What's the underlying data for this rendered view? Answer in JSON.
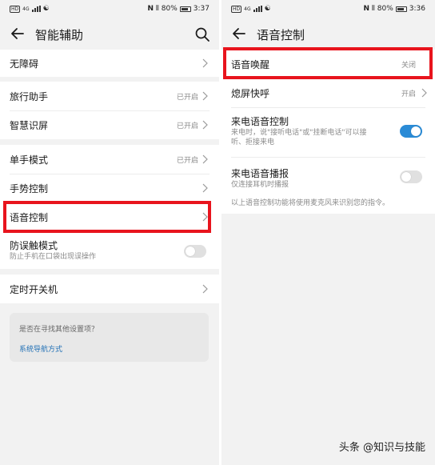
{
  "left": {
    "status": {
      "carrier": "HD",
      "signal": "4G",
      "battery": "80%",
      "time": "3:37"
    },
    "title": "智能辅助",
    "items": [
      {
        "label": "无障碍"
      },
      {
        "label": "旅行助手",
        "value": "已开启"
      },
      {
        "label": "智慧识屏",
        "value": "已开启"
      },
      {
        "label": "单手模式",
        "value": "已开启"
      },
      {
        "label": "手势控制"
      },
      {
        "label": "语音控制"
      },
      {
        "label": "防误触模式",
        "sub": "防止手机在口袋出现误操作",
        "toggle": "off"
      },
      {
        "label": "定时开关机"
      }
    ],
    "hint": {
      "question": "是否在寻找其他设置项？",
      "link": "系统导航方式"
    }
  },
  "right": {
    "status": {
      "carrier": "HD",
      "signal": "4G",
      "battery": "80%",
      "time": "3:36"
    },
    "title": "语音控制",
    "items": [
      {
        "label": "语音唤醒",
        "value": "关闭"
      },
      {
        "label": "熄屏快呼",
        "value": "开启"
      },
      {
        "label": "来电语音控制",
        "sub1": "来电时，说\"接听电话\"或\"挂断电话\"可以接",
        "sub2": "听、拒接来电",
        "toggle": "on"
      },
      {
        "label": "来电语音播报",
        "sub": "仅连接耳机时播报",
        "toggle": "off"
      }
    ],
    "note": "以上语音控制功能将使用麦克风来识别您的指令。"
  },
  "watermark": "头条 @知识与技能",
  "colors": {
    "highlight": "#e8141d",
    "accent": "#2a8bd6",
    "link": "#1f6fb5"
  }
}
